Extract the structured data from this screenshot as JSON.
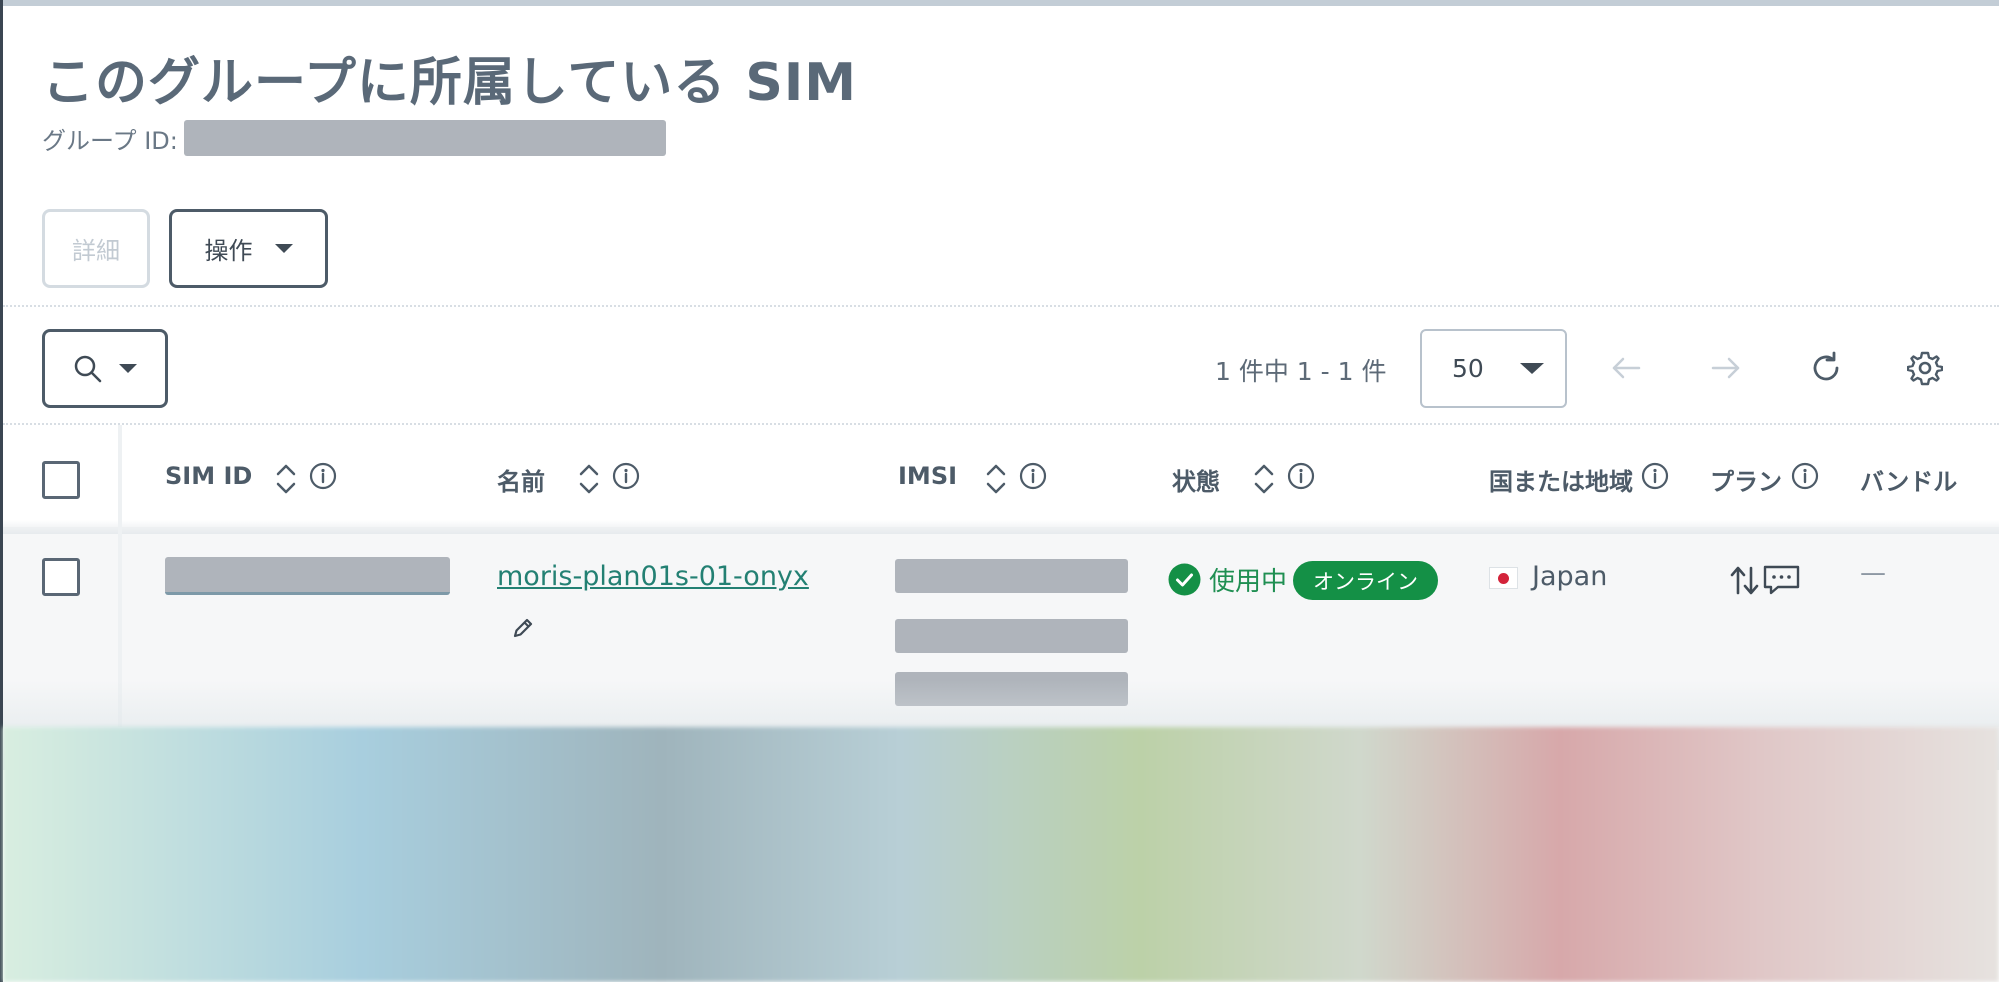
{
  "header": {
    "title": "このグループに所属している SIM",
    "group_id_label": "グループ ID:"
  },
  "toolbar": {
    "detail_label": "詳細",
    "action_label": "操作"
  },
  "pagination": {
    "count_text": "1 件中 1 - 1 件",
    "per_page": "50"
  },
  "icons": {
    "search": "search-icon",
    "prev": "arrow-left-icon",
    "next": "arrow-right-icon",
    "refresh": "refresh-icon",
    "settings": "gear-icon"
  },
  "table": {
    "columns": [
      "SIM ID",
      "名前",
      "IMSI",
      "状態",
      "国または地域",
      "プラン",
      "バンドル"
    ],
    "rows": [
      {
        "name": "moris-plan01s-01-onyx",
        "status": "使用中",
        "online_badge": "オンライン",
        "country": "Japan",
        "bundle": "—"
      }
    ]
  },
  "colors": {
    "link": "#238073",
    "status_green": "#149046",
    "border_dark": "#4d5b68"
  }
}
